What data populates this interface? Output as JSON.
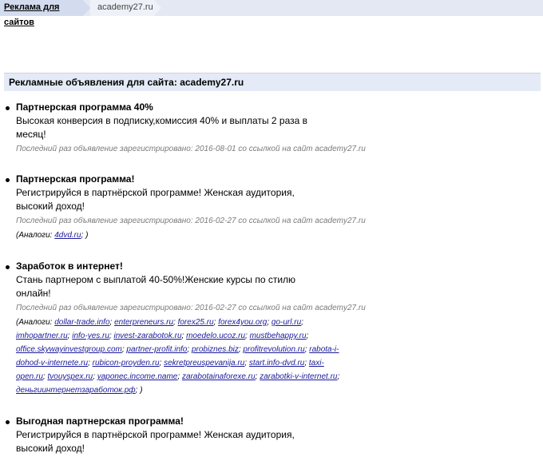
{
  "breadcrumb": {
    "root_label": "Реклама для сайтов",
    "current_label": "academy27.ru"
  },
  "section_title": "Рекламные объявления для сайта: academy27.ru",
  "analogs_prefix": "(Аналоги:",
  "analogs_suffix": ")",
  "ads": [
    {
      "title": "Партнерская программа 40%",
      "description": "Высокая конверсия в подписку,комиссия 40% и выплаты 2 раза в месяц!",
      "meta": "Последний раз объявление зарегистрировано: 2016-08-01 со ссылкой на сайт academy27.ru",
      "analogs": []
    },
    {
      "title": "Партнерская программа!",
      "description": "Регистрируйся в партнёрской программе! Женская аудитория, высокий доход!",
      "meta": "Последний раз объявление зарегистрировано: 2016-02-27 со ссылкой на сайт academy27.ru",
      "analogs": [
        "4dvd.ru"
      ]
    },
    {
      "title": "Заработок в интернет!",
      "description": "Стань партнером с выплатой 40-50%!Женские курсы по стилю онлайн!",
      "meta": "Последний раз объявление зарегистрировано: 2016-02-27 со ссылкой на сайт academy27.ru",
      "analogs": [
        "dollar-trade.info",
        "enterpreneurs.ru",
        "forex25.ru",
        "forex4you.org",
        "go-url.ru",
        "imhopartner.ru",
        "info-yes.ru",
        "invest-zarabotok.ru",
        "moedelo.ucoz.ru",
        "mustbehappy.ru",
        "office.skywayinvestgroup.com",
        "partner-profit.info",
        "probiznes.biz",
        "profitrevolution.ru",
        "rabota-i-dohod-v-internete.ru",
        "rubicon-proyden.ru",
        "sekretpreuspevanija.ru",
        "start.info-dvd.ru",
        "taxi-open.ru",
        "tvouyspex.ru",
        "yaponec.income.name",
        "zarabotainaforexe.ru",
        "zarabotki-v-internet.ru",
        "деньгиинтернетзаработок.рф"
      ]
    },
    {
      "title": "Выгодная партнерская программа!",
      "description": "Регистрируйся в партнёрской программе! Женская аудитория, высокий доход!",
      "meta": "",
      "analogs": []
    }
  ]
}
